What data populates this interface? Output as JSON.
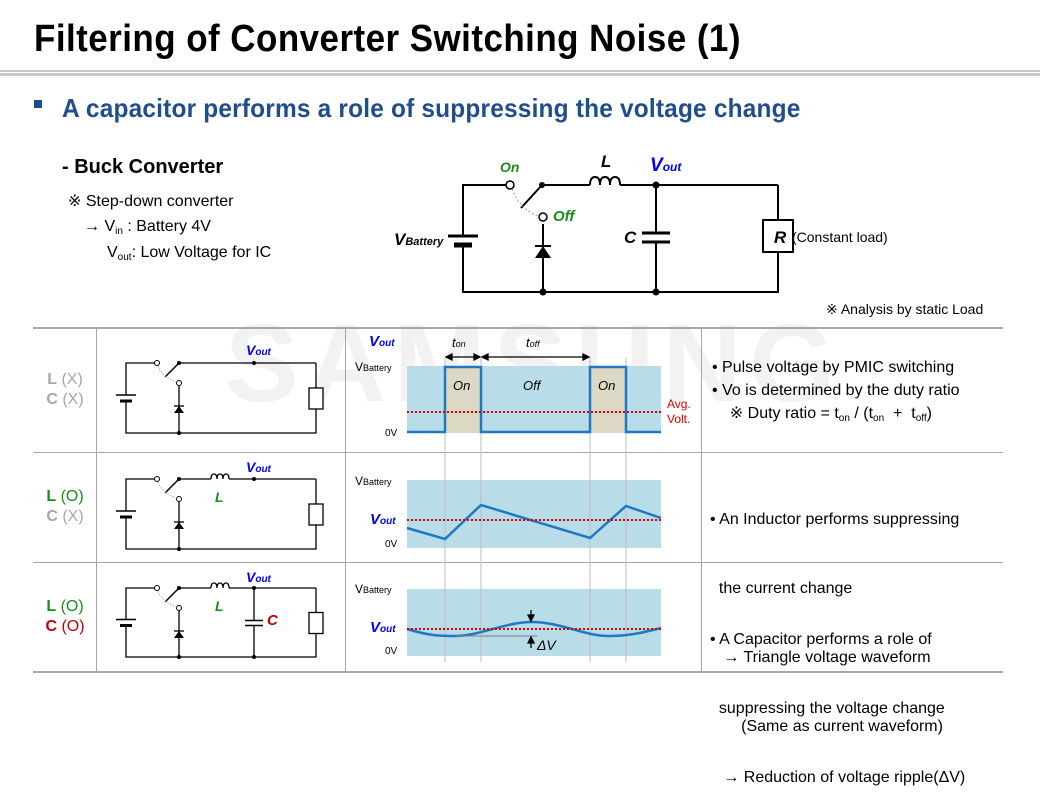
{
  "header": {
    "title": "Filtering of Converter Switching Noise (1)",
    "subtitle": "A capacitor performs a role of suppressing the voltage change"
  },
  "watermark": "SAMSUNG",
  "buck": {
    "title": "- Buck Converter",
    "note": "※ Step-down converter",
    "vin_prefix": "→ V",
    "vin_sub": "in",
    "vin_value": " :  Battery  4V",
    "vout_prefix": "V",
    "vout_sub": "out",
    "vout_value": ":  Low Voltage for IC"
  },
  "circuit": {
    "on_label": "On",
    "off_label": "Off",
    "inductor_label": "L",
    "vout_label": "V",
    "vout_sub": "out",
    "battery_label": "V",
    "battery_sub": "Battery",
    "cap_label": "C",
    "res_label": "R",
    "res_note": "(Constant load)",
    "analysis_note": "※  Analysis by static Load"
  },
  "colors": {
    "title_blue": "#1f4e8c",
    "vout_blue": "#0000ff",
    "green": "#1a8c1a",
    "red": "#c00000",
    "wave_bg": "#b8dde8",
    "on_bg": "#ddd8c4",
    "wave_line": "#1f78c1",
    "avg_line": "#e00000"
  },
  "rows": [
    {
      "l_label": "L",
      "l_state": "(X)",
      "c_label": "C",
      "c_state": "(X)",
      "vout": "V",
      "vout_sub": "out",
      "wave": {
        "vout_label": "V",
        "vout_sub": "out",
        "vbat": "V",
        "vbat_sub": "Battery",
        "zero": "0V",
        "t_on": "t",
        "t_on_sub": "on",
        "t_off": "t",
        "t_off_sub": "off",
        "on1": "On",
        "off": "Off",
        "on2": "On",
        "avg1": "Avg.",
        "avg2": "Volt."
      },
      "desc": [
        "•  Pulse voltage by PMIC switching",
        "•  Vo is determined by the duty ratio",
        "    ※ Duty ratio = t",
        "on",
        " / (t",
        "on",
        "  +  t",
        "off",
        ")"
      ]
    },
    {
      "l_label": "L",
      "l_state": "(O)",
      "c_label": "C",
      "c_state": "(X)",
      "vout": "V",
      "vout_sub": "out",
      "inductor": "L",
      "wave": {
        "vbat": "V",
        "vbat_sub": "Battery",
        "vout_label": "V",
        "vout_sub": "out",
        "zero": "0V"
      },
      "desc": [
        "• An Inductor performs suppressing",
        "  the current change",
        "   → Triangle voltage waveform",
        "       (Same as current waveform)"
      ]
    },
    {
      "l_label": "L",
      "l_state": "(O)",
      "c_label": "C",
      "c_state": "(O)",
      "vout": "V",
      "vout_sub": "out",
      "inductor": "L",
      "cap": "C",
      "wave": {
        "vbat": "V",
        "vbat_sub": "Battery",
        "vout_label": "V",
        "vout_sub": "out",
        "zero": "0V",
        "delta": "ΔV"
      },
      "desc": [
        "• A Capacitor performs a role of",
        "  suppressing the voltage change",
        "   → Reduction of voltage ripple(ΔV)"
      ]
    }
  ]
}
